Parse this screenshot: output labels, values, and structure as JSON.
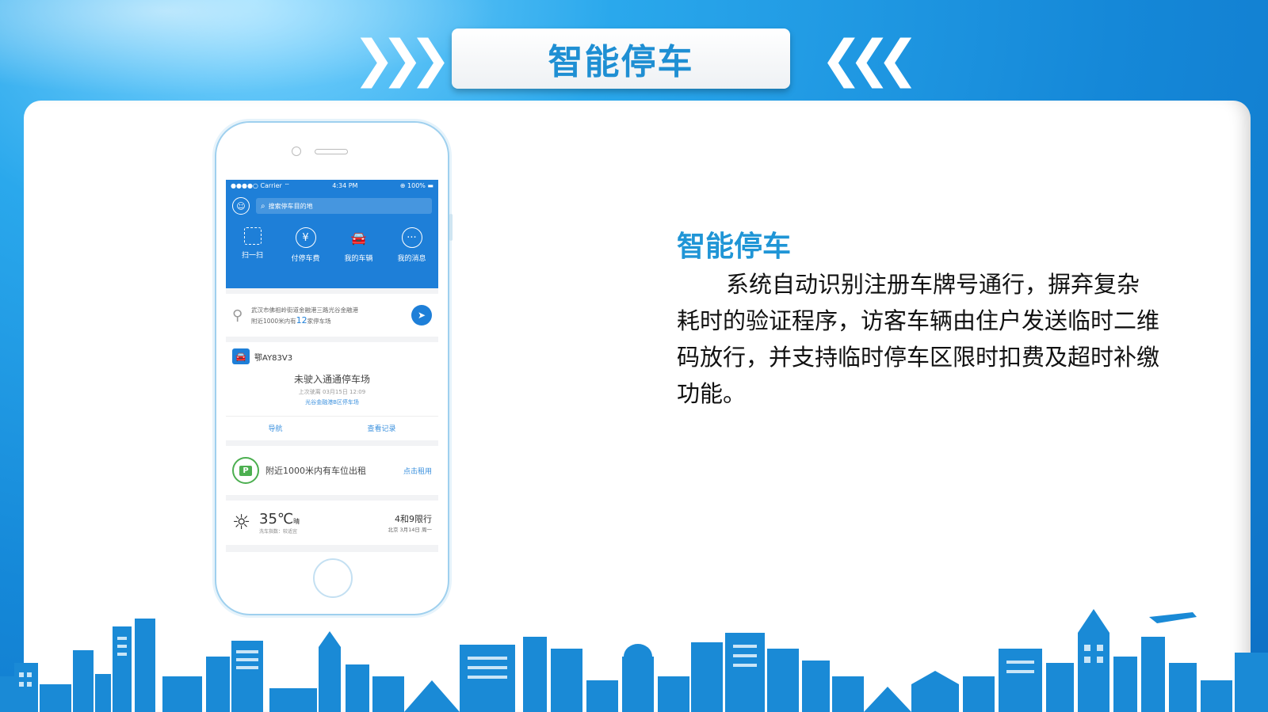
{
  "header": {
    "title": "智能停车",
    "left_chevrons": "❯❯❯",
    "right_chevrons": "❮❮❮"
  },
  "phone": {
    "status": {
      "carrier": "●●●●○ Carrier ⌔",
      "time": "4:34 PM",
      "battery": "⊕ 100% ▬"
    },
    "search_placeholder": "搜索停车目的地",
    "icons": {
      "avatar": "user-icon",
      "search": "search-icon"
    },
    "tools": [
      {
        "label": "扫一扫",
        "icon": "scan-icon",
        "glyph": ""
      },
      {
        "label": "付停车费",
        "icon": "yuan-icon",
        "glyph": "¥"
      },
      {
        "label": "我的车辆",
        "icon": "car-icon",
        "glyph": "🚘"
      },
      {
        "label": "我的消息",
        "icon": "message-icon",
        "glyph": "···"
      }
    ],
    "location": {
      "address": "武汉市佛祖岭街道金融港三路光谷金融港",
      "nearby_prefix": "附近1000米内有",
      "nearby_count": "12",
      "nearby_suffix": "家停车场"
    },
    "car": {
      "plate": "鄂AY83V3",
      "status": "未驶入通通停车场",
      "last_leave": "上次驶离 03月15日 12:09",
      "lot": "光谷金融港B区停车场",
      "actions": [
        "导航",
        "查看记录"
      ]
    },
    "rent": {
      "icon_label": "P",
      "text": "附近1000米内有车位出租",
      "link": "点击租用"
    },
    "weather": {
      "temp": "35℃",
      "condition": "晴",
      "tip": "洗车指数：较适宜",
      "limit": "4和9限行",
      "limit_sub": "北京 3月14日 周一"
    }
  },
  "content": {
    "heading": "智能停车",
    "paragraph": "系统自动识别注册车牌号通行，摒弃复杂耗时的验证程序，访客车辆由住户发送临时二维码放行，并支持临时停车区限时扣费及超时补缴功能。"
  },
  "colors": {
    "accent": "#1f95d6",
    "app_blue": "#1e7fd8",
    "skyline": "#1a8ad6"
  }
}
